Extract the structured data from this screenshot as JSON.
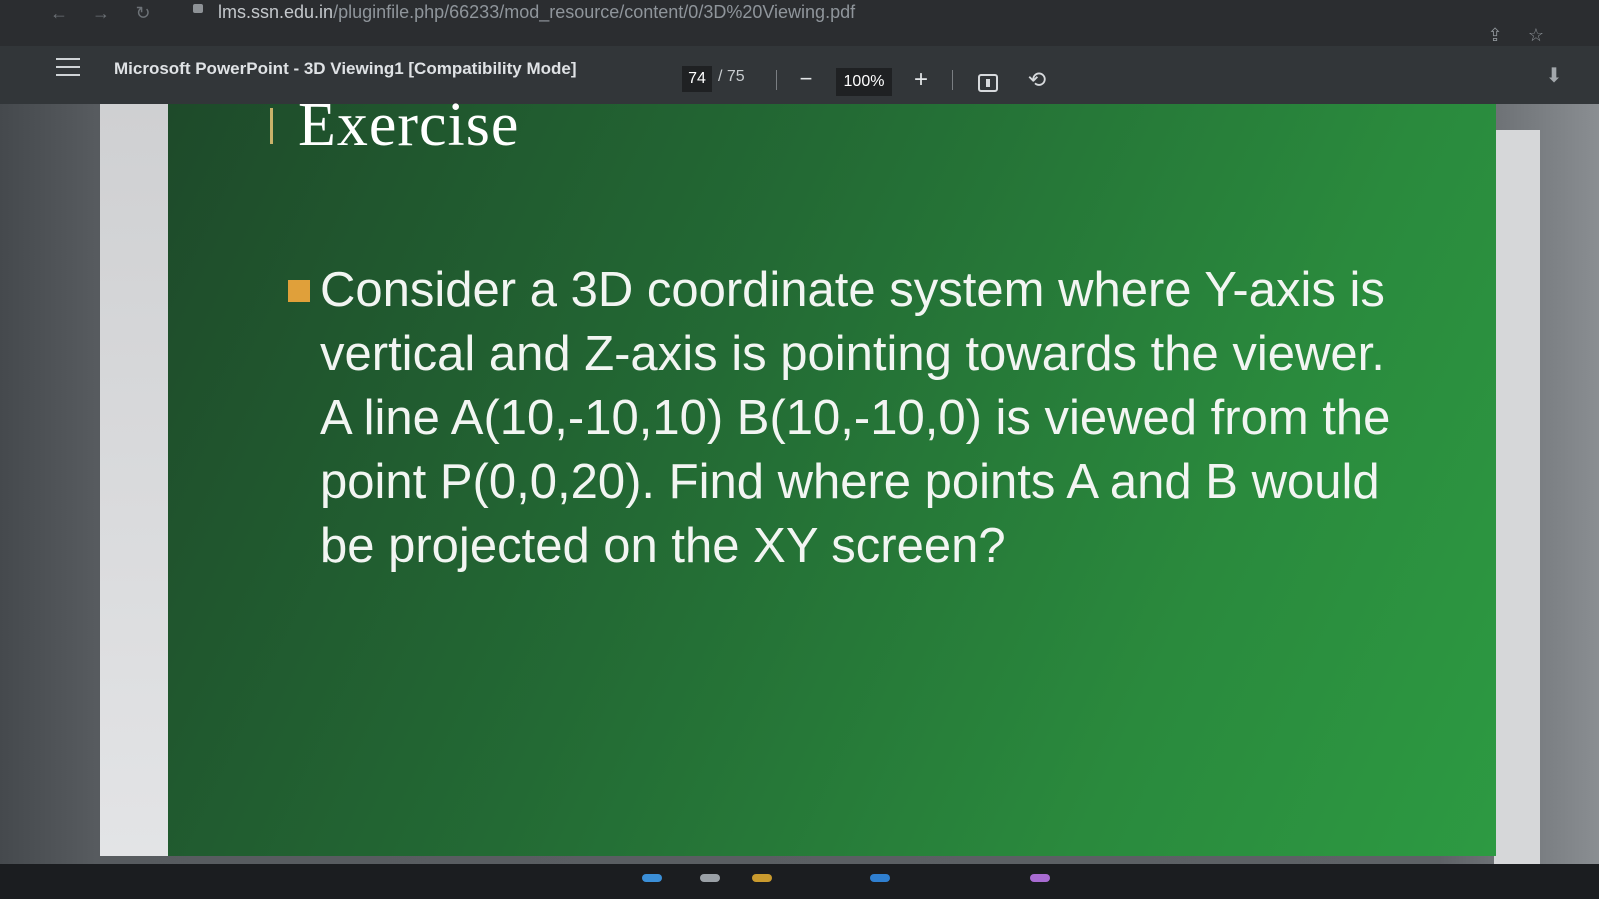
{
  "browser": {
    "url_host": "lms.ssn.edu.in",
    "url_path": "/pluginfile.php/66233/mod_resource/content/0/3D%20Viewing.pdf",
    "icons": [
      "back-arrow-icon",
      "forward-arrow-icon",
      "reload-icon",
      "lock-icon",
      "share-icon",
      "star-icon"
    ]
  },
  "pdf_toolbar": {
    "title": "Microsoft PowerPoint - 3D Viewing1 [Compatibility Mode]",
    "current_page": "74",
    "total_pages": "/ 75",
    "zoom": "100%",
    "zoom_out_symbol": "−",
    "zoom_in_symbol": "+",
    "icons": [
      "menu-icon",
      "fit-page-icon",
      "rotate-icon",
      "download-icon"
    ]
  },
  "slide": {
    "title": "Exercise",
    "body": "Consider a 3D coordinate system where Y-axis is vertical and Z-axis is pointing towards the viewer. A line A(10,-10,10) B(10,-10,0) is viewed from the point P(0,0,20). Find where points A and B would be projected on the XY screen?",
    "bullet_color": "#e0a03a",
    "background_color": "#2a7d3a"
  }
}
